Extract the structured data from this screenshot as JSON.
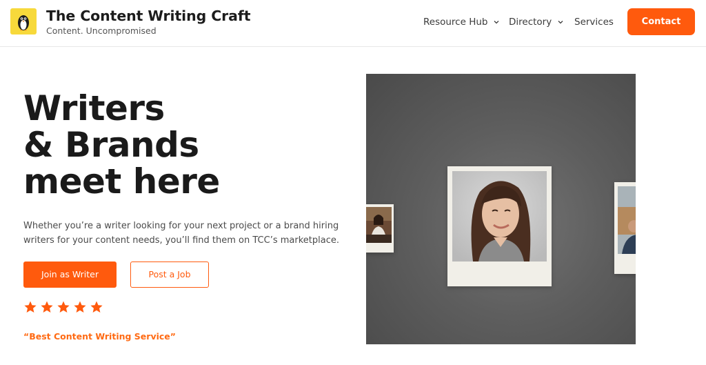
{
  "header": {
    "brand_title": "The Content Writing Craft",
    "brand_tagline": "Content. Uncompromised",
    "logo_icon": "penguin-logo-icon",
    "nav": [
      {
        "label": "Resource Hub",
        "has_dropdown": true
      },
      {
        "label": "Directory",
        "has_dropdown": true
      },
      {
        "label": "Services",
        "has_dropdown": false
      }
    ],
    "contact_label": "Contact"
  },
  "hero": {
    "title_lines": [
      "Writers",
      "& Brands",
      "meet here"
    ],
    "description": "Whether you’re a writer looking for your next project or a brand hiring writers for your content needs, you’ll find them on TCC’s marketplace.",
    "primary_cta": "Join as Writer",
    "secondary_cta": "Post a Job",
    "rating": 5,
    "quote": "“Best Content Writing Service”"
  },
  "gallery": {
    "photos": [
      "woman-portrait",
      "woman-at-desk",
      "man-outdoors"
    ]
  },
  "colors": {
    "accent": "#ff5a0d",
    "logo_bg": "#f7d93b",
    "text_dark": "#1a1a1a",
    "gallery_bg": "#5e5e5e",
    "polaroid": "#f1efe8"
  }
}
